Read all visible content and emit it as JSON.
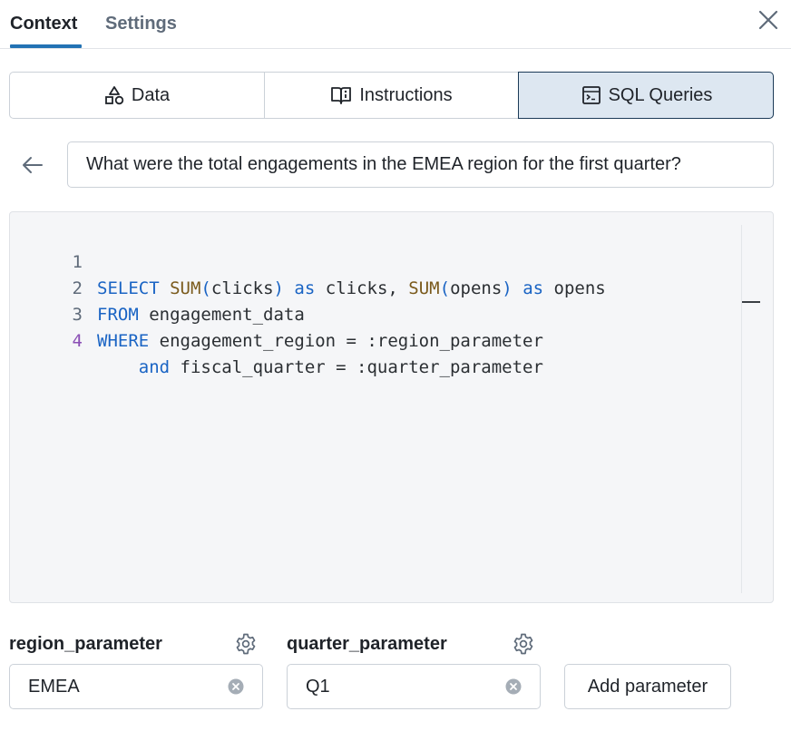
{
  "tabs": {
    "context": "Context",
    "settings": "Settings"
  },
  "segments": {
    "data": "Data",
    "instructions": "Instructions",
    "sql_queries": "SQL Queries"
  },
  "question": "What were the total engagements in the EMEA region for the first quarter?",
  "code": {
    "line_numbers": [
      "1",
      "2",
      "3",
      "4"
    ],
    "line1": {
      "kw1": "SELECT",
      "fn1": "SUM",
      "p1": "(",
      "a1": "clicks",
      "p2": ")",
      "kw2": "as",
      "t1": "clicks,",
      "fn2": "SUM",
      "p3": "(",
      "a2": "opens",
      "p4": ")",
      "kw3": "as",
      "t2": "opens"
    },
    "line2": {
      "kw": "FROM",
      "t": "engagement_data"
    },
    "line3": {
      "kw": "WHERE",
      "t": "engagement_region = :region_parameter"
    },
    "line4": {
      "kw": "and",
      "t": "fiscal_quarter = :quarter_parameter"
    }
  },
  "parameters": [
    {
      "name": "region_parameter",
      "value": "EMEA"
    },
    {
      "name": "quarter_parameter",
      "value": "Q1"
    }
  ],
  "add_parameter_label": "Add parameter",
  "icons": {
    "close": "close-icon",
    "data": "shapes-icon",
    "instructions": "book-icon",
    "sql": "terminal-icon",
    "back": "arrow-left-icon",
    "gear": "gear-icon",
    "clear": "clear-circle-icon"
  },
  "colors": {
    "accent": "#2272b4",
    "selected_segment": "#dde7f1",
    "keyword": "#1a64c4",
    "function": "#7a5a1c"
  }
}
